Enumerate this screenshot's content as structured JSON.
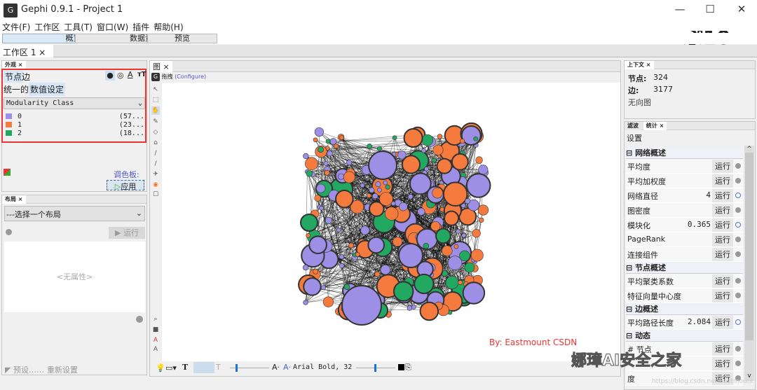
{
  "window": {
    "title": "Gephi 0.9.1 - Project 1",
    "minimize": "—",
    "maximize": "☐",
    "close": "✕"
  },
  "menu": [
    "文件(F)",
    "工作区",
    "工具(T)",
    "窗口(W)",
    "插件",
    "帮助(H)"
  ],
  "modes": [
    "概览",
    "数据资料",
    "预览"
  ],
  "workspace_tab": "工作区 1",
  "appearance": {
    "tab": "外观",
    "element_tabs": [
      "节点",
      "边"
    ],
    "mode_tabs": [
      "统一的",
      "数值设定"
    ],
    "attribute": "Modularity Class",
    "legend": [
      {
        "label": "0",
        "pct": "(57...",
        "color": "#9d8fe6"
      },
      {
        "label": "1",
        "pct": "(23...",
        "color": "#f57a3d"
      },
      {
        "label": "2",
        "pct": "(18...",
        "color": "#23a862"
      }
    ],
    "palette_label": "调色板:",
    "apply": "应用"
  },
  "layout": {
    "tab": "布局",
    "select": "---选择一个布局",
    "run": "运行",
    "no_props": "<无属性>",
    "presets": "预设……",
    "reset": "重新设置"
  },
  "graph": {
    "tab": "图",
    "drag": "拖拽",
    "configure": "(Configure)",
    "watermark": "By: Eastmount CSDN",
    "font": "Arial Bold, 32",
    "colors": {
      "purple": "#9d8fe6",
      "orange": "#f57a3d",
      "green": "#23a862"
    }
  },
  "context": {
    "tab": "上下文",
    "nodes_label": "节点:",
    "nodes": "324",
    "edges_label": "边:",
    "edges": "3177",
    "type": "无向图"
  },
  "statistics": {
    "tabs": [
      "滤波",
      "统计"
    ],
    "settings": "设置",
    "run": "运行",
    "sections": [
      {
        "title": "网络概述",
        "rows": [
          {
            "name": "平均度",
            "value": ""
          },
          {
            "name": "平均加权度",
            "value": ""
          },
          {
            "name": "网络直径",
            "value": "4"
          },
          {
            "name": "图密度",
            "value": ""
          },
          {
            "name": "模块化",
            "value": "0.365"
          },
          {
            "name": "PageRank",
            "value": ""
          },
          {
            "name": "连接组件",
            "value": ""
          }
        ]
      },
      {
        "title": "节点概述",
        "rows": [
          {
            "name": "平均聚类系数",
            "value": ""
          },
          {
            "name": "特征向量中心度",
            "value": ""
          }
        ]
      },
      {
        "title": "边概述",
        "rows": [
          {
            "name": "平均路径长度",
            "value": "2.084"
          }
        ]
      },
      {
        "title": "动态",
        "rows": [
          {
            "name": "# 节点",
            "value": ""
          },
          {
            "name": "",
            "value": ""
          },
          {
            "name": "度",
            "value": ""
          }
        ]
      }
    ]
  },
  "overlay": {
    "brand": "娜璋AI安全之家",
    "url": "https://blog.csdn.net/Eastmount"
  }
}
